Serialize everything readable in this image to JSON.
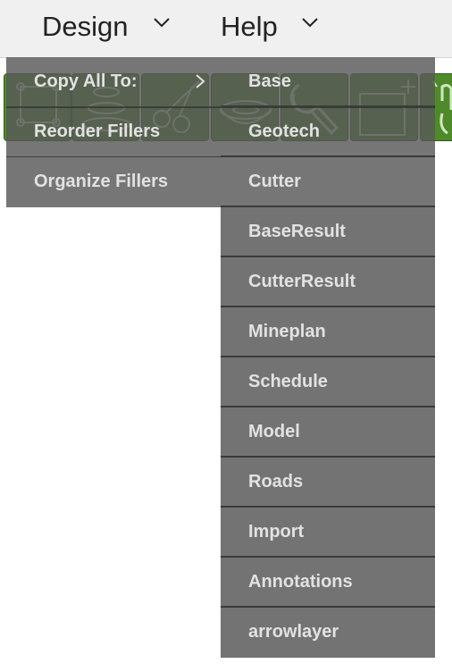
{
  "menubar": {
    "design_label": "Design",
    "help_label": "Help"
  },
  "design_menu": {
    "items": [
      {
        "label": "Copy All To:"
      },
      {
        "label": "Reorder Fillers"
      },
      {
        "label": "Organize Fillers"
      }
    ]
  },
  "copy_submenu": {
    "items": [
      {
        "label": "Base"
      },
      {
        "label": "Geotech"
      },
      {
        "label": "Cutter"
      },
      {
        "label": "BaseResult"
      },
      {
        "label": "CutterResult"
      },
      {
        "label": "Mineplan"
      },
      {
        "label": "Schedule"
      },
      {
        "label": "Model"
      },
      {
        "label": "Roads"
      },
      {
        "label": "Import"
      },
      {
        "label": "Annotations"
      },
      {
        "label": "arrowlayer"
      }
    ]
  },
  "toolbar": {
    "icons": [
      "select-box-icon",
      "layers-icon",
      "scissors-icon",
      "bowl-icon",
      "wrench-icon",
      "new-shape-icon",
      "hand-pointer-icon"
    ]
  },
  "colors": {
    "menu_bg": "#585858",
    "menu_text": "#e2e2e2",
    "toolbar_green": "#4f8a2a",
    "menubar_bg": "#f0f0f0"
  }
}
